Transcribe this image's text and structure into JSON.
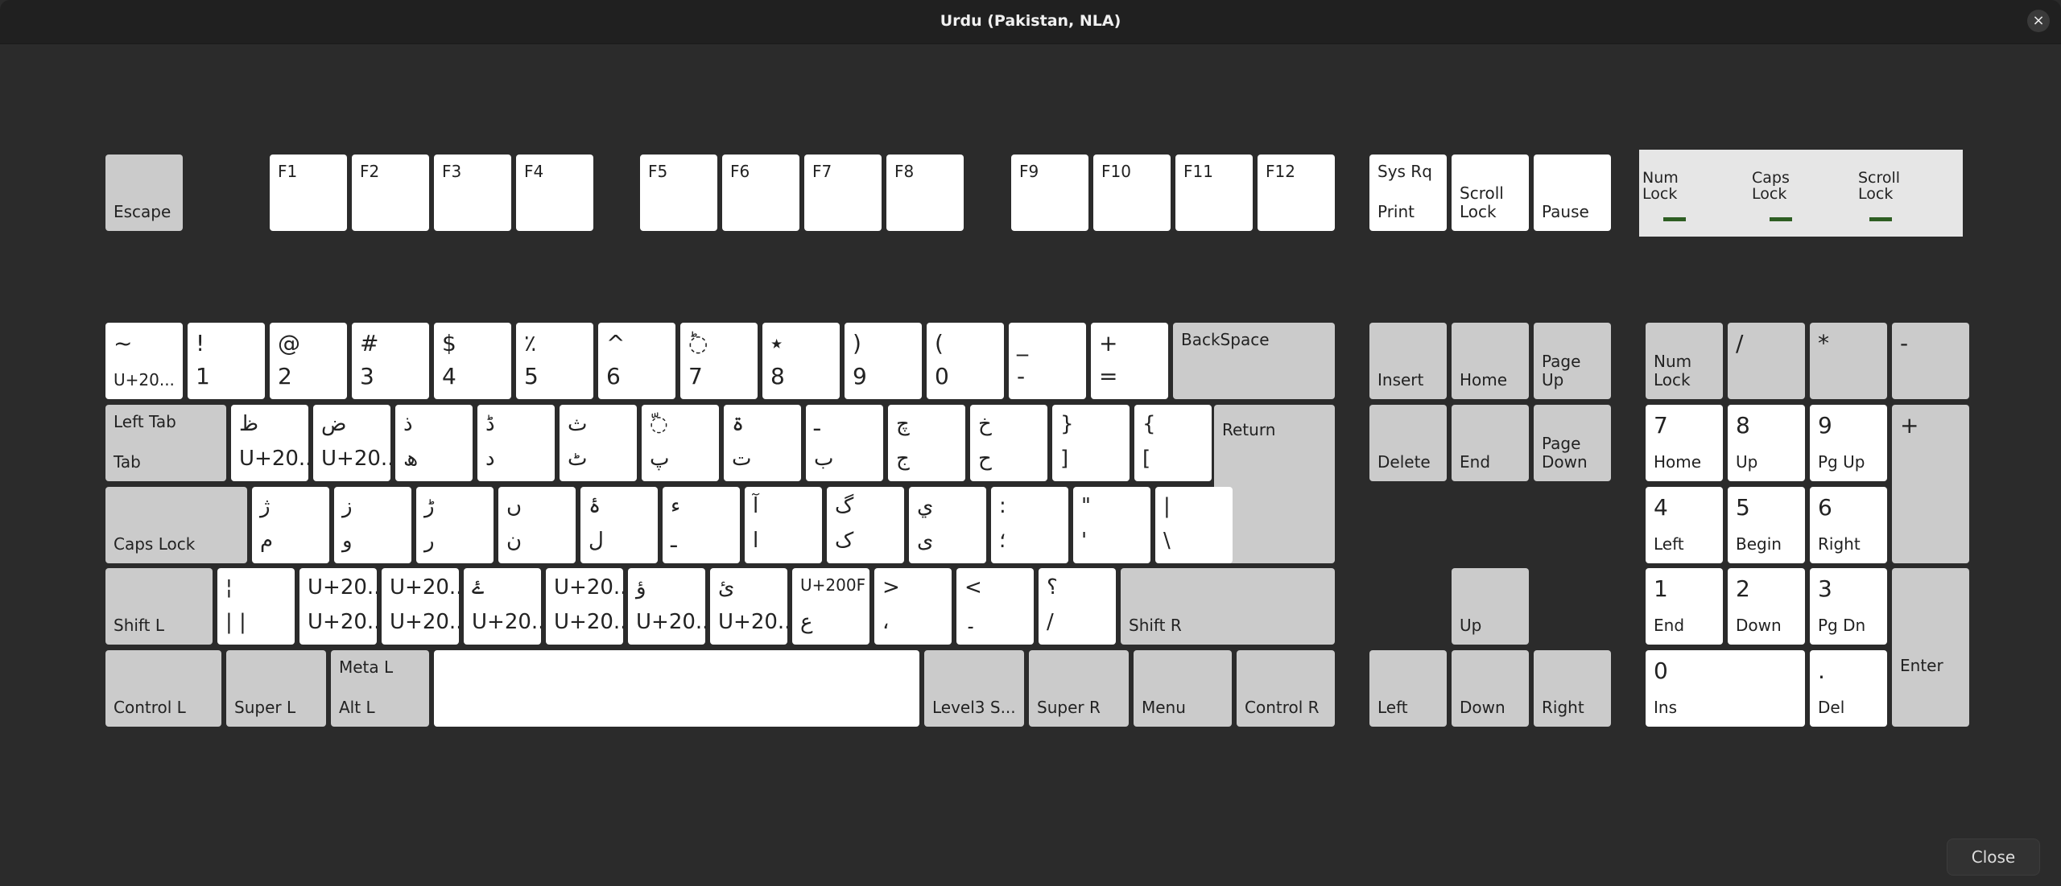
{
  "window": {
    "title": "Urdu (Pakistan, NLA)",
    "close_icon": "×",
    "close_button": "Close"
  },
  "leds": [
    {
      "label": "Num\nLock",
      "on": false,
      "color": "#2e5e23"
    },
    {
      "label": "Caps\nLock",
      "on": false,
      "color": "#2e5e23"
    },
    {
      "label": "Scroll\nLock",
      "on": false,
      "color": "#2e5e23"
    }
  ],
  "keys": {
    "escape": {
      "top": "",
      "bottom": "Escape"
    },
    "f1": "F1",
    "f2": "F2",
    "f3": "F3",
    "f4": "F4",
    "f5": "F5",
    "f6": "F6",
    "f7": "F7",
    "f8": "F8",
    "f9": "F9",
    "f10": "F10",
    "f11": "F11",
    "f12": "F12",
    "print": {
      "top": "Sys Rq",
      "bottom": "Print"
    },
    "scroll": {
      "bottom": "Scroll\nLock"
    },
    "pause": {
      "bottom": "Pause"
    },
    "number_row": [
      {
        "top": "~",
        "bottom": "U+20..."
      },
      {
        "top": "!",
        "bottom": "1"
      },
      {
        "top": "@",
        "bottom": "2"
      },
      {
        "top": "#",
        "bottom": "3"
      },
      {
        "top": "$",
        "bottom": "4"
      },
      {
        "top": "٪",
        "bottom": "5"
      },
      {
        "top": "^",
        "bottom": "6"
      },
      {
        "top": "◌ؕ",
        "bottom": "7"
      },
      {
        "top": "٭",
        "bottom": "8"
      },
      {
        "top": ")",
        "bottom": "9"
      },
      {
        "top": "(",
        "bottom": "0"
      },
      {
        "top": "_",
        "bottom": "-"
      },
      {
        "top": "+",
        "bottom": "="
      }
    ],
    "backspace": "BackSpace",
    "tab": {
      "top": "Left Tab",
      "bottom": "Tab"
    },
    "q_row": [
      {
        "top": "ظ",
        "bottom": "U+20..."
      },
      {
        "top": "ض",
        "bottom": "U+20..."
      },
      {
        "top": "ذ",
        "bottom": "ھ"
      },
      {
        "top": "ڈ",
        "bottom": "د"
      },
      {
        "top": "ث",
        "bottom": "ٹ"
      },
      {
        "top": "◌ّ",
        "bottom": "پ"
      },
      {
        "top": "ۃ",
        "bottom": "ت"
      },
      {
        "top": "ـ",
        "bottom": "ب"
      },
      {
        "top": "چ",
        "bottom": "ج"
      },
      {
        "top": "خ",
        "bottom": "ح"
      },
      {
        "top": "}",
        "bottom": "]"
      },
      {
        "top": "{",
        "bottom": "["
      }
    ],
    "return": "Return",
    "caps": "Caps Lock",
    "a_row": [
      {
        "top": "ژ",
        "bottom": "م"
      },
      {
        "top": "ز",
        "bottom": "و"
      },
      {
        "top": "ڑ",
        "bottom": "ر"
      },
      {
        "top": "ں",
        "bottom": "ن"
      },
      {
        "top": "ۂ",
        "bottom": "ل"
      },
      {
        "top": "ء",
        "bottom": "ـ"
      },
      {
        "top": "آ",
        "bottom": "ا"
      },
      {
        "top": "گ",
        "bottom": "ک"
      },
      {
        "top": "ي",
        "bottom": "ی"
      },
      {
        "top": ":",
        "bottom": "؛"
      },
      {
        "top": "\"",
        "bottom": "'"
      },
      {
        "top": "|",
        "bottom": "\\"
      }
    ],
    "shift_l": "Shift L",
    "z_row": [
      {
        "top": "¦",
        "bottom": "|    |"
      },
      {
        "top": "U+20...",
        "bottom": "U+20..."
      },
      {
        "top": "U+20...",
        "bottom": "U+20..."
      },
      {
        "top": "ۓ",
        "bottom": "U+20..."
      },
      {
        "top": "U+20...",
        "bottom": "U+20..."
      },
      {
        "top": "ؤ",
        "bottom": "U+20..."
      },
      {
        "top": "ئ",
        "bottom": "U+20..."
      },
      {
        "top": "U+200F",
        "bottom": "ع"
      },
      {
        "top": ">",
        "bottom": "،"
      },
      {
        "top": "<",
        "bottom": "۔"
      },
      {
        "top": "؟",
        "bottom": "/"
      }
    ],
    "shift_r": "Shift R",
    "control_l": "Control L",
    "super_l": "Super L",
    "alt_l": {
      "top": "Meta L",
      "bottom": "Alt L"
    },
    "space": "",
    "level3": "Level3 S...",
    "super_r": "Super R",
    "menu": "Menu",
    "control_r": "Control R",
    "insert": "Insert",
    "home": "Home",
    "page_up": "Page\nUp",
    "delete": "Delete",
    "end": "End",
    "page_down": "Page\nDown",
    "up": "Up",
    "left": "Left",
    "down": "Down",
    "right": "Right",
    "kp_numlock": "Num\nLock",
    "kp_divide": "/",
    "kp_multiply": "*",
    "kp_minus": "-",
    "kp7": {
      "top": "7",
      "bottom": "Home"
    },
    "kp8": {
      "top": "8",
      "bottom": "Up"
    },
    "kp9": {
      "top": "9",
      "bottom": "Pg Up"
    },
    "kp_plus": "+",
    "kp4": {
      "top": "4",
      "bottom": "Left"
    },
    "kp5": {
      "top": "5",
      "bottom": "Begin"
    },
    "kp6": {
      "top": "6",
      "bottom": "Right"
    },
    "kp1": {
      "top": "1",
      "bottom": "End"
    },
    "kp2": {
      "top": "2",
      "bottom": "Down"
    },
    "kp3": {
      "top": "3",
      "bottom": "Pg Dn"
    },
    "kp_enter": "Enter",
    "kp0": {
      "top": "0",
      "bottom": "Ins"
    },
    "kp_decimal": {
      "top": ".",
      "bottom": "Del"
    }
  }
}
